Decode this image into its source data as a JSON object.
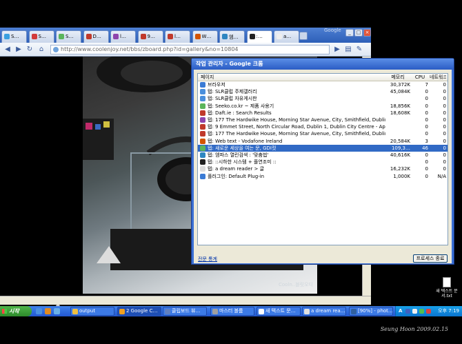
{
  "browser": {
    "tabs": [
      {
        "label": "S…",
        "color": "#3aa0e0"
      },
      {
        "label": "S…",
        "color": "#d23b3b"
      },
      {
        "label": "S…",
        "color": "#5bb55b"
      },
      {
        "label": "D…",
        "color": "#c0392b"
      },
      {
        "label": "l…",
        "color": "#8e44ad"
      },
      {
        "label": "9…",
        "color": "#c0392b"
      },
      {
        "label": "l…",
        "color": "#c0392b"
      },
      {
        "label": "W…",
        "color": "#d35400"
      },
      {
        "label": "엠…",
        "color": "#2e86c1"
      },
      {
        "label": ":…",
        "color": "#222222"
      },
      {
        "label": "a…",
        "color": "#eeeeee"
      }
    ],
    "url": "http://www.coolenjoy.net/bbs/zboard.php?id=gallery&no=10804",
    "top_right_label": "Google"
  },
  "photo": {
    "watermark": "Cooln..블릿오디"
  },
  "taskmgr": {
    "title": "작업 관리자 - Google 크롬",
    "columns": {
      "page": "페이지",
      "memory": "메모리",
      "cpu": "CPU",
      "network": "네트워크"
    },
    "rows": [
      {
        "page": "브라우저",
        "memory": "30,372K",
        "cpu": "7",
        "network": "0",
        "icon": "#3a7bd5"
      },
      {
        "page": "탭: SLR클럽 주제갤러리",
        "memory": "45,084K",
        "cpu": "0",
        "network": "0",
        "icon": "#4a8fdc"
      },
      {
        "page": "탭: SLR클럽 자유게시판",
        "memory": "",
        "cpu": "0",
        "network": "0",
        "icon": "#4a8fdc"
      },
      {
        "page": "탭: Seeko.co.kr ~ 제품 사용기",
        "memory": "18,856K",
        "cpu": "0",
        "network": "0",
        "icon": "#5bb55b"
      },
      {
        "page": "탭: Daft.ie : Search Results",
        "memory": "18,608K",
        "cpu": "0",
        "network": "0",
        "icon": "#c0392b"
      },
      {
        "page": "탭: 177 The Hardwike House, Morning Star Avenue, City, Smithfield, Dublin 7, Dublin C…",
        "memory": "",
        "cpu": "0",
        "network": "0",
        "icon": "#8e44ad"
      },
      {
        "page": "탭: 9 Emmet Street, North Circular Road, Dublin 1, Dublin City Centre - Apartment share",
        "memory": "",
        "cpu": "0",
        "network": "0",
        "icon": "#c0392b"
      },
      {
        "page": "탭: 177 The Hardwike House, Morning Star Avenue, City, Smithfield, Dublin 7, Dublin C…",
        "memory": "",
        "cpu": "0",
        "network": "0",
        "icon": "#c0392b"
      },
      {
        "page": "탭: Web text - Vodafone Ireland",
        "memory": "20,584K",
        "cpu": "3",
        "network": "0",
        "icon": "#d35400"
      },
      {
        "page": "탭: 새로운 세상을 여는 문, GDI컷",
        "memory": "109,3…",
        "cpu": "46",
        "network": "0",
        "icon": "#5bb55b",
        "selected": true
      },
      {
        "page": "탭: 엠파스 열린검색 : '맞춤법'",
        "memory": "40,616K",
        "cpu": "0",
        "network": "0",
        "icon": "#2e86c1"
      },
      {
        "page": "탭: ::시하한 시스템 + 플연조미 ::",
        "memory": "",
        "cpu": "0",
        "network": "0",
        "icon": "#222222"
      },
      {
        "page": "탭: a dream reader > 글",
        "memory": "16,232K",
        "cpu": "0",
        "network": "0",
        "icon": "#dddddd"
      },
      {
        "page": "플러그인: Default Plug-in",
        "memory": "1,000K",
        "cpu": "0",
        "network": "N/A",
        "icon": "#3a7bd5"
      }
    ],
    "stats_link": "전문 통계",
    "end_process": "프로세스 종료"
  },
  "desktop_icon": {
    "label": "새 텍스트 문서.txt"
  },
  "taskbar": {
    "start": "시작",
    "buttons": [
      {
        "label": "output",
        "color": "#f0c040"
      },
      {
        "label": "2 Google C…",
        "color": "#f0a020",
        "active": true
      },
      {
        "label": "클립보드 뷰…",
        "color": "#6080c0"
      },
      {
        "label": "마스터 볼륨",
        "color": "#a0a0a0"
      },
      {
        "label": "새 텍스트 문…",
        "color": "#ffffff"
      },
      {
        "label": "a dream rea…",
        "color": "#e0e0e0"
      },
      {
        "label": "[90%] - phot…",
        "color": "#3060a0"
      }
    ],
    "tray_lang": "A",
    "clock": "오후 7:19"
  },
  "signature": "Seung Hoon 2009.02.15"
}
